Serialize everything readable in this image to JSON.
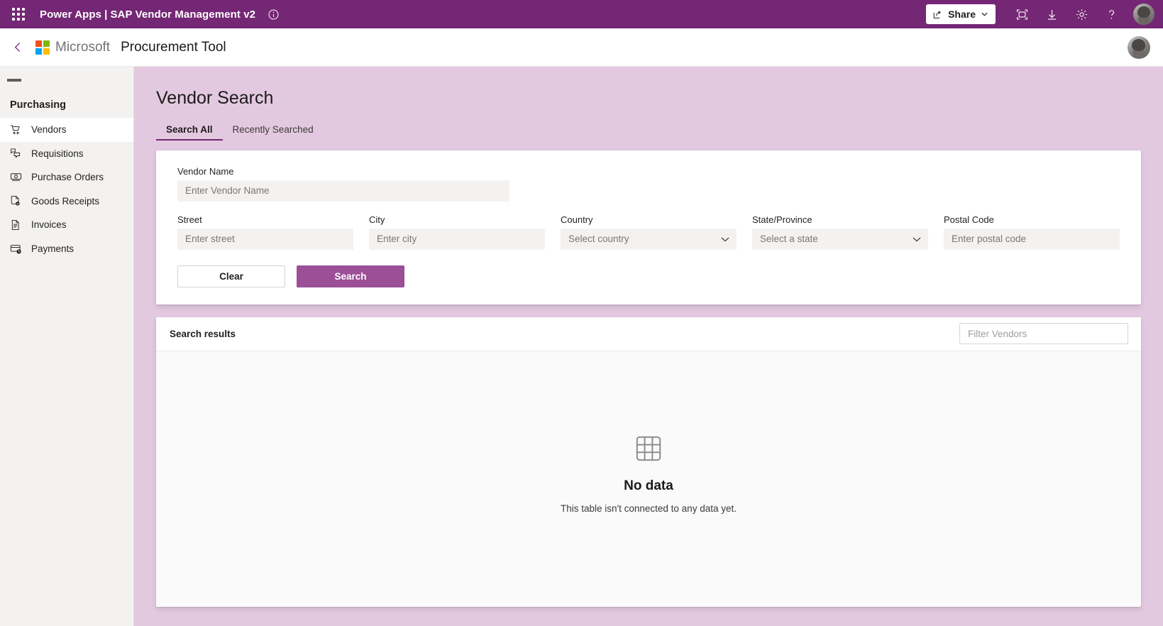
{
  "command_bar": {
    "waffle_label": "app-launcher",
    "product": "Power Apps",
    "separator": "|",
    "app_title": "SAP Vendor Management v2",
    "info_icon": "info-icon",
    "share_label": "Share",
    "share_chevron": "⌄",
    "icons": [
      {
        "name": "fit-to-screen-icon",
        "glyph": "❐"
      },
      {
        "name": "download-icon",
        "glyph": "↓"
      },
      {
        "name": "gear-icon",
        "glyph": "⚙"
      },
      {
        "name": "help-icon",
        "glyph": "?"
      }
    ],
    "avatar": "user-avatar"
  },
  "app_header": {
    "back_label": "back",
    "microsoft": "Microsoft",
    "app_name": "Procurement Tool",
    "avatar": "user-avatar"
  },
  "sidebar": {
    "menu_toggle": "hamburger-menu",
    "section_title": "Purchasing",
    "items": [
      {
        "label": "Vendors",
        "icon": "shopping-cart-icon",
        "active": true
      },
      {
        "label": "Requisitions",
        "icon": "requisitions-icon",
        "active": false
      },
      {
        "label": "Purchase Orders",
        "icon": "money-icon",
        "active": false
      },
      {
        "label": "Goods Receipts",
        "icon": "receipt-check-icon",
        "active": false
      },
      {
        "label": "Invoices",
        "icon": "invoice-doc-icon",
        "active": false
      },
      {
        "label": "Payments",
        "icon": "payment-card-icon",
        "active": false
      }
    ]
  },
  "main": {
    "page_title": "Vendor Search",
    "tabs": [
      {
        "label": "Search All",
        "selected": true
      },
      {
        "label": "Recently Searched",
        "selected": false
      }
    ],
    "form": {
      "vendor_name": {
        "label": "Vendor Name",
        "placeholder": "Enter Vendor Name",
        "value": ""
      },
      "street": {
        "label": "Street",
        "placeholder": "Enter street",
        "value": ""
      },
      "city": {
        "label": "City",
        "placeholder": "Enter city",
        "value": ""
      },
      "country": {
        "label": "Country",
        "placeholder": "Select country",
        "value": ""
      },
      "state": {
        "label": "State/Province",
        "placeholder": "Select a state",
        "value": ""
      },
      "postal_code": {
        "label": "Postal Code",
        "placeholder": "Enter postal code",
        "value": ""
      },
      "clear_label": "Clear",
      "search_label": "Search"
    },
    "results": {
      "title": "Search results",
      "filter_placeholder": "Filter Vendors",
      "filter_value": "",
      "empty_icon": "table-grid-icon",
      "empty_title": "No data",
      "empty_subtitle": "This table isn't connected to any data yet."
    }
  },
  "colors": {
    "command_bar": "#742774",
    "accent": "#9b4f96",
    "canvas": "#e3c9e0",
    "sidebar": "#f3f2f1",
    "card": "#ffffff"
  }
}
